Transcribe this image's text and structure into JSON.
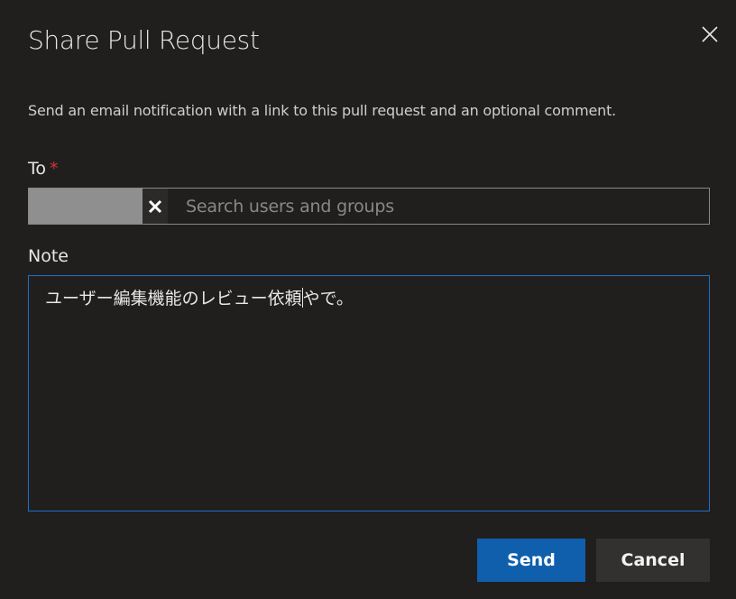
{
  "dialog": {
    "title": "Share Pull Request",
    "description": "Send an email notification with a link to this pull request and an optional comment.",
    "close_icon": "close-icon"
  },
  "to": {
    "label": "To",
    "required_marker": "*",
    "placeholder": "Search users and groups",
    "chip_remove_icon": "close-icon"
  },
  "note": {
    "label": "Note",
    "value_before_caret": "ユーザー編集機能のレビュー依頼",
    "value_after_caret": "やで。"
  },
  "actions": {
    "send_label": "Send",
    "cancel_label": "Cancel"
  },
  "colors": {
    "background": "#201f1e",
    "accent": "#0f5fad",
    "focus_border": "#1f6fc4",
    "required": "#d13438"
  }
}
